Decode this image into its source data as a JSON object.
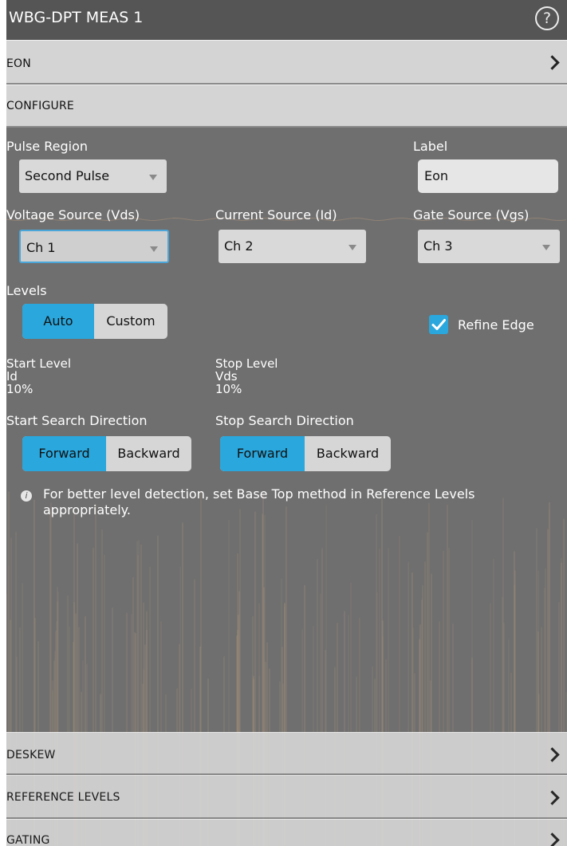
{
  "window": {
    "title": "WBG-DPT MEAS 1",
    "help_icon": "help-circle-icon",
    "help_glyph": "?"
  },
  "sections": {
    "eon": {
      "label": "EON"
    },
    "configure": {
      "label": "CONFIGURE"
    },
    "deskew": {
      "label": "DESKEW"
    },
    "reference_levels": {
      "label": "REFERENCE LEVELS"
    },
    "gating": {
      "label": "GATING"
    }
  },
  "pulse_region": {
    "label": "Pulse Region",
    "value": "Second Pulse"
  },
  "label_field": {
    "label": "Label",
    "value": "Eon"
  },
  "voltage_source": {
    "label": "Voltage Source (Vds)",
    "value": "Ch 1"
  },
  "current_source": {
    "label": "Current Source (Id)",
    "value": "Ch 2"
  },
  "gate_source": {
    "label": "Gate Source (Vgs)",
    "value": "Ch 3"
  },
  "levels": {
    "label": "Levels",
    "options": [
      "Auto",
      "Custom"
    ],
    "selected": "Auto"
  },
  "refine_edge": {
    "label": "Refine Edge",
    "checked": true
  },
  "start_level": {
    "title": "Start Level",
    "source": "Id",
    "value": "10%"
  },
  "stop_level": {
    "title": "Stop Level",
    "source": "Vds",
    "value": "10%"
  },
  "start_search": {
    "label": "Start Search Direction",
    "options": [
      "Forward",
      "Backward"
    ],
    "selected": "Forward"
  },
  "stop_search": {
    "label": "Stop Search Direction",
    "options": [
      "Forward",
      "Backward"
    ],
    "selected": "Forward"
  },
  "info": {
    "line1": "For better level detection, set Base Top method in Reference Levels",
    "line2": "appropriately.",
    "icon": "info-icon"
  },
  "colors": {
    "panel_bg": "#6f6f6f",
    "title_bg": "#555555",
    "section_bg": "#d4d4d4",
    "accent": "#2aa7dc",
    "waveform": "#b89a7c"
  }
}
